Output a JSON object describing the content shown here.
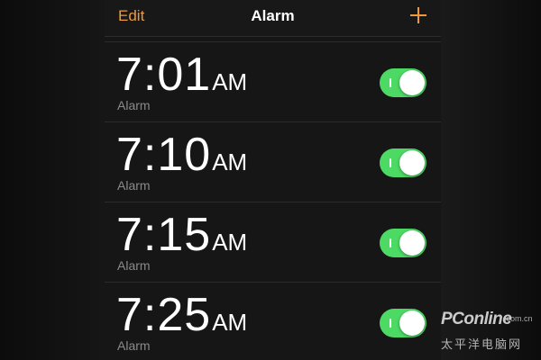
{
  "colors": {
    "accent": "#f09a37",
    "toggle_on": "#4cd964",
    "background": "#161616",
    "secondary_text": "#8a8a8a"
  },
  "navbar": {
    "edit_label": "Edit",
    "title": "Alarm",
    "add_icon": "plus-icon"
  },
  "alarms": [
    {
      "time": "7:01",
      "ampm": "AM",
      "label": "Alarm",
      "enabled": true
    },
    {
      "time": "7:10",
      "ampm": "AM",
      "label": "Alarm",
      "enabled": true
    },
    {
      "time": "7:15",
      "ampm": "AM",
      "label": "Alarm",
      "enabled": true
    },
    {
      "time": "7:25",
      "ampm": "AM",
      "label": "Alarm",
      "enabled": true
    }
  ],
  "watermark": {
    "brand": "PConline",
    "domain": ".com.cn",
    "chinese": "太平洋电脑网"
  }
}
